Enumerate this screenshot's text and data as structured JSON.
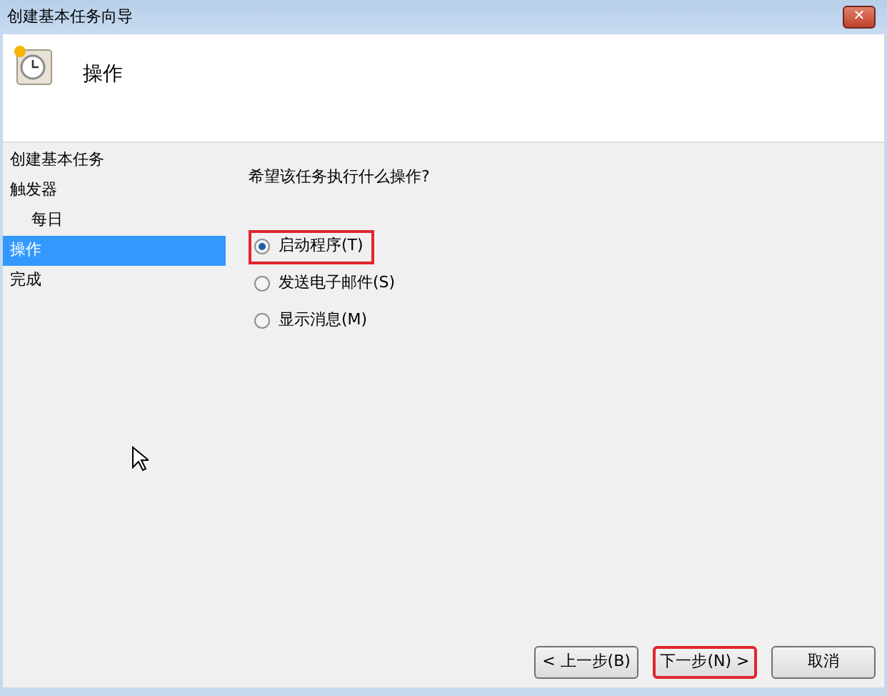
{
  "window": {
    "title": "创建基本任务向导",
    "close": "✕"
  },
  "header": {
    "title": "操作"
  },
  "steps": [
    {
      "label": "创建基本任务",
      "selected": false
    },
    {
      "label": "触发器",
      "selected": false,
      "children": [
        {
          "label": "每日",
          "selected": false
        }
      ]
    },
    {
      "label": "操作",
      "selected": true
    },
    {
      "label": "完成",
      "selected": false
    }
  ],
  "question": "希望该任务执行什么操作?",
  "options": [
    {
      "label": "启动程序(T)",
      "selected": true,
      "highlighted": true
    },
    {
      "label": "发送电子邮件(S)",
      "selected": false,
      "highlighted": false
    },
    {
      "label": "显示消息(M)",
      "selected": false,
      "highlighted": false
    }
  ],
  "buttons": [
    {
      "label": "< 上一步(B)",
      "highlighted": false
    },
    {
      "label": "下一步(N) >",
      "highlighted": true
    },
    {
      "label": "取消",
      "highlighted": false
    }
  ]
}
